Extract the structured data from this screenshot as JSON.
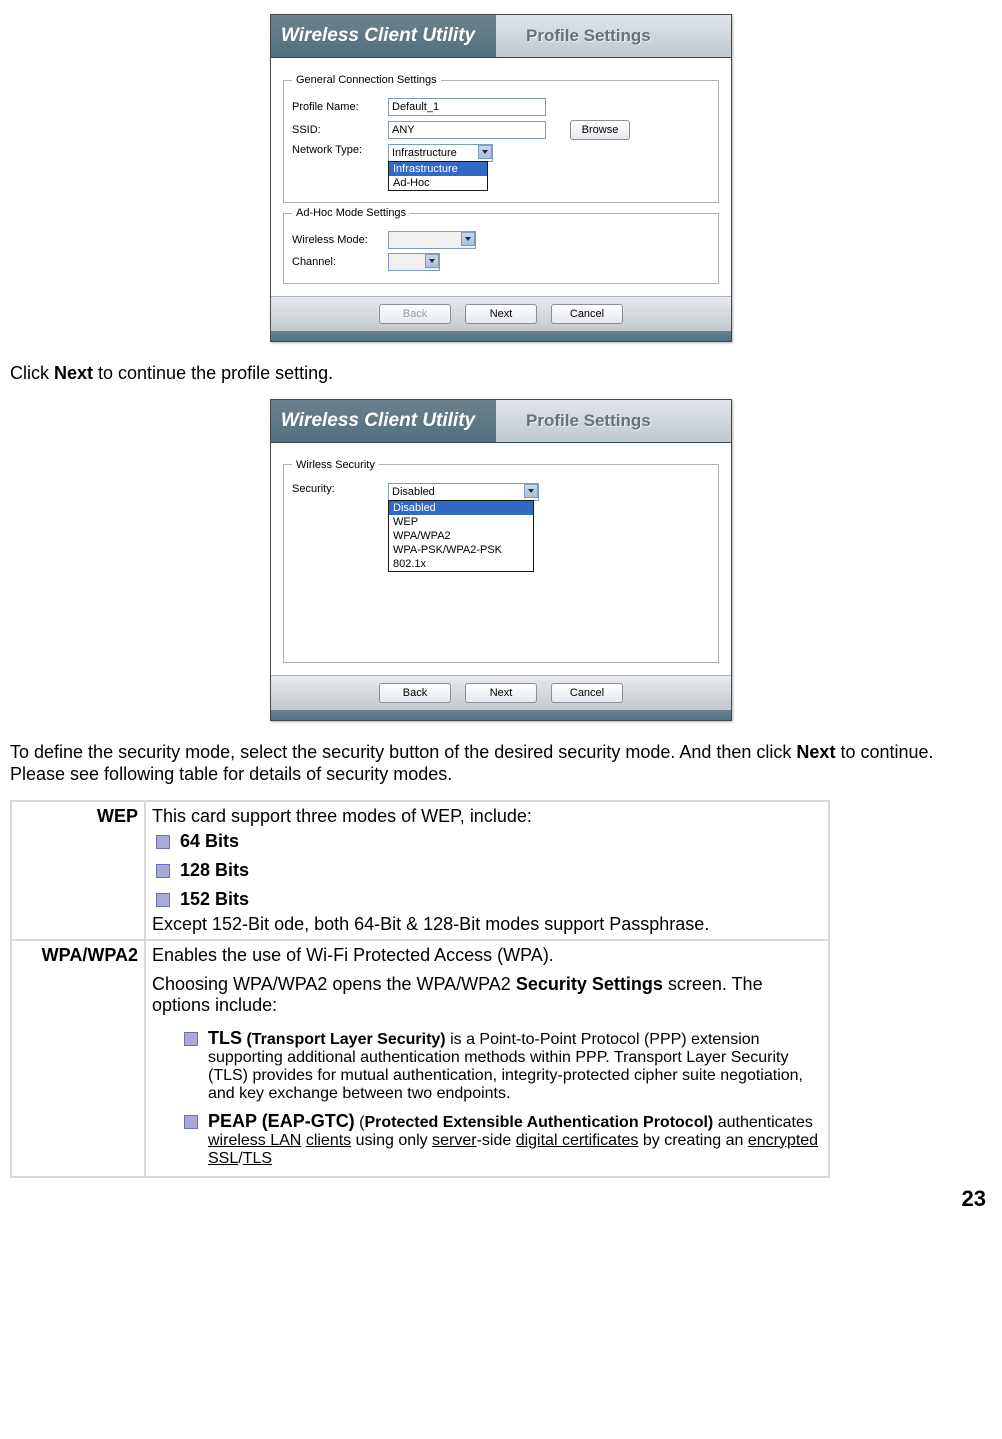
{
  "page_number": "23",
  "app_title": "Wireless Client Utility",
  "tab_title": "Profile Settings",
  "dialog1": {
    "group1_legend": "General Connection Settings",
    "profile_label": "Profile Name:",
    "profile_value": "Default_1",
    "ssid_label": "SSID:",
    "ssid_value": "ANY",
    "browse_label": "Browse",
    "nettype_label": "Network Type:",
    "nettype_value": "Infrastructure",
    "nettype_options": [
      "Infrastructure",
      "Ad-Hoc"
    ],
    "group2_legend": "Ad-Hoc Mode Settings",
    "wmode_label": "Wireless Mode:",
    "channel_label": "Channel:",
    "back_label": "Back",
    "next_label": "Next",
    "cancel_label": "Cancel"
  },
  "text1_a": "Click ",
  "text1_b": "Next",
  "text1_c": " to continue the profile setting.",
  "dialog2": {
    "group_legend": "Wirless Security",
    "sec_label": "Security:",
    "sec_value": "Disabled",
    "sec_options": [
      "Disabled",
      "WEP",
      "WPA/WPA2",
      "WPA-PSK/WPA2-PSK",
      "802.1x"
    ],
    "back_label": "Back",
    "next_label": "Next",
    "cancel_label": "Cancel"
  },
  "text2_a": "To define the security mode, select the security button of the desired security mode. And then click ",
  "text2_b": "Next",
  "text2_c": " to continue. Please see following table for details of security modes.",
  "table": {
    "wep": {
      "title": "WEP",
      "intro": "This card support three modes of WEP, include:",
      "opt1": "64 Bits",
      "opt2": "128 Bits",
      "opt3": "152 Bits",
      "footer": "Except 152-Bit ode, both 64-Bit & 128-Bit modes support Passphrase."
    },
    "wpa": {
      "title": "WPA/WPA2",
      "p1": "Enables the use of Wi-Fi Protected Access (WPA).",
      "p2a": "Choosing WPA/WPA2 opens the WPA/WPA2 ",
      "p2b": "Security Settings",
      "p2c": " screen. The options include:",
      "tls_bold": "TLS",
      "tls_paren": " (Transport Layer Security)",
      "tls_body": " is a Point-to-Point Protocol (PPP) extension supporting additional authentication methods within PPP. Transport Layer Security (TLS) provides for mutual authentication, integrity-protected cipher suite negotiation, and key exchange between two endpoints.",
      "peap_bold": "PEAP (EAP-GTC)",
      "peap_open": "  (",
      "peap_paren_bold": "Protected Extensible Authentication Protocol)",
      "peap_body_a": " authenticates ",
      "peap_u1": "wireless LAN",
      "peap_sp": " ",
      "peap_u2": "clients",
      "peap_body_b": " using only ",
      "peap_u3": "server",
      "peap_body_c": "-side ",
      "peap_u4": "digital certificates",
      "peap_body_d": " by creating an ",
      "peap_u5": "encrypted",
      "peap_sp2": " ",
      "peap_u6": "SSL",
      "peap_slash": "/",
      "peap_u7": "TLS"
    }
  }
}
